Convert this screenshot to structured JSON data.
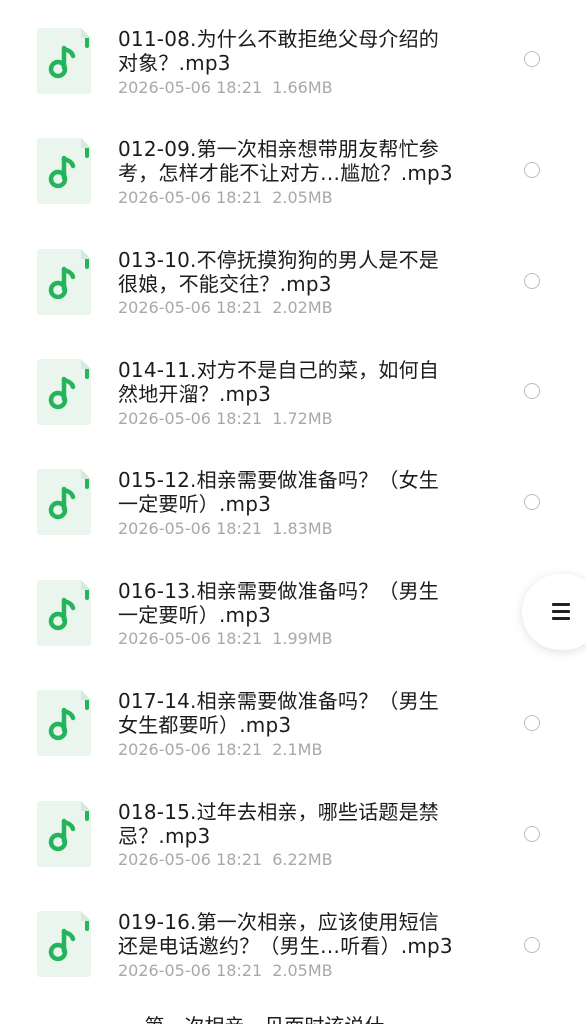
{
  "files": [
    {
      "title": "011-08.为什么不敢拒绝父母介绍的\n对象？.mp3",
      "date": "2026-05-06 18:21",
      "size": "1.66MB"
    },
    {
      "title": "012-09.第一次相亲想带朋友帮忙参\n考，怎样才能不让对方…尴尬？.mp3",
      "date": "2026-05-06 18:21",
      "size": "2.05MB"
    },
    {
      "title": "013-10.不停抚摸狗狗的男人是不是\n很娘，不能交往？.mp3",
      "date": "2026-05-06 18:21",
      "size": "2.02MB"
    },
    {
      "title": "014-11.对方不是自己的菜，如何自\n然地开溜？.mp3",
      "date": "2026-05-06 18:21",
      "size": "1.72MB"
    },
    {
      "title": "015-12.相亲需要做准备吗？（女生\n一定要听）.mp3",
      "date": "2026-05-06 18:21",
      "size": "1.83MB"
    },
    {
      "title": "016-13.相亲需要做准备吗？（男生\n一定要听）.mp3",
      "date": "2026-05-06 18:21",
      "size": "1.99MB"
    },
    {
      "title": "017-14.相亲需要做准备吗？（男生\n女生都要听）.mp3",
      "date": "2026-05-06 18:21",
      "size": "2.1MB"
    },
    {
      "title": "018-15.过年去相亲，哪些话题是禁\n忌？.mp3",
      "date": "2026-05-06 18:21",
      "size": "6.22MB"
    },
    {
      "title": "019-16.第一次相亲，应该使用短信\n还是电话邀约？（男生…听看）.mp3",
      "date": "2026-05-06 18:21",
      "size": "2.05MB"
    }
  ],
  "partial_next_title": "… 第一次相亲，见面时该说什",
  "icons": {
    "file_icon": "music-note-icon",
    "menu_icon": "menu-icon"
  },
  "colors": {
    "accent": "#24b45b",
    "icon_bg": "#e9f5ed",
    "title": "#1c1c1c",
    "meta": "#a8a8a8"
  }
}
